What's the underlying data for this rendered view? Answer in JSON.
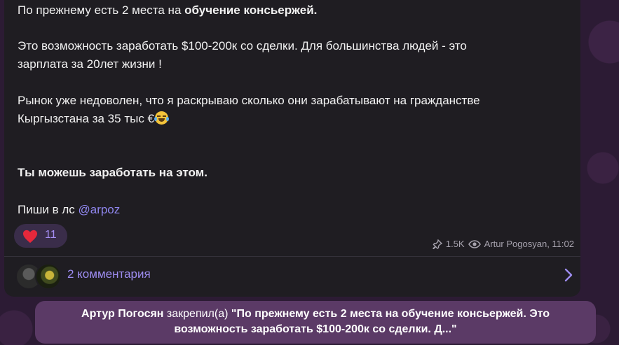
{
  "message": {
    "line1_prefix": "По прежнему есть 2 места на ",
    "line1_bold": "обучение консьержей.",
    "line2": "Это возможность заработать $100-200к со сделки. Для большинства людей - это",
    "line3": "зарплата за 20лет жизни !",
    "line4": "Рынок уже недоволен, что я раскрываю сколько они зарабатывают на гражданстве",
    "line5": "Кыргызстана за 35 тыс €",
    "line6_bold": "Ты можешь заработать на этом.",
    "line7_prefix": "Пиши в лс ",
    "line7_link": "@arpoz"
  },
  "reaction": {
    "emoji": "heart-icon",
    "count": "11"
  },
  "meta": {
    "views": "1.5K",
    "author_time": "Artur Pogosyan, 11:02"
  },
  "comments": {
    "label": "2 комментария"
  },
  "pin_banner": {
    "actor": "Артур Погосян",
    "action": " закрепил(а) ",
    "quote_line1": "\"По прежнему есть 2 места на обучение консьержей. Это",
    "quote_line2": "возможность заработать $100-200к со сделки. Д...\""
  },
  "colors": {
    "bubble": "#1f1d22",
    "accent": "#9d8cf0",
    "banner": "#5b3a66"
  }
}
